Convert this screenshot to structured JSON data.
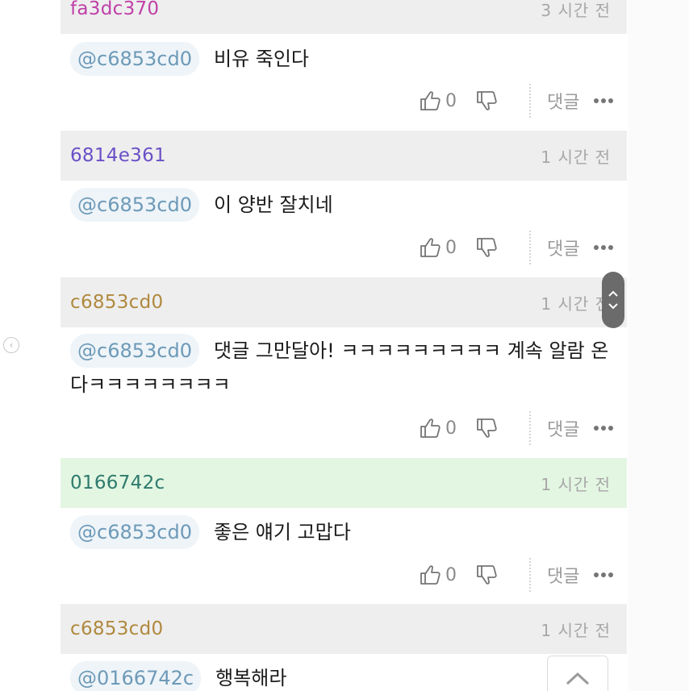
{
  "comments": [
    {
      "author": "fa3dc370",
      "author_color": "#c040a8",
      "time": "3 시간 전",
      "highlighted": false,
      "mention": "@c6853cd0",
      "text": "비유 죽인다",
      "likes": "0",
      "reply_label": "댓글"
    },
    {
      "author": "6814e361",
      "author_color": "#6a4fc7",
      "time": "1 시간 전",
      "highlighted": false,
      "mention": "@c6853cd0",
      "text": "이 양반 잘치네",
      "likes": "0",
      "reply_label": "댓글"
    },
    {
      "author": "c6853cd0",
      "author_color": "#b0893e",
      "time": "1 시간 전",
      "highlighted": false,
      "mention": "@c6853cd0",
      "text": "댓글 그만달아! ㅋㅋㅋㅋㅋㅋㅋㅋㅋ 계속 알람 온다ㅋㅋㅋㅋㅋㅋㅋㅋ",
      "likes": "0",
      "reply_label": "댓글"
    },
    {
      "author": "0166742c",
      "author_color": "#2e7a6c",
      "time": "1 시간 전",
      "highlighted": true,
      "mention": "@c6853cd0",
      "text": "좋은 얘기 고맙다",
      "likes": "0",
      "reply_label": "댓글"
    },
    {
      "author": "c6853cd0",
      "author_color": "#b0893e",
      "time": "1 시간 전",
      "highlighted": false,
      "mention": "@0166742c",
      "text": "행복해라",
      "likes": null,
      "reply_label": null
    }
  ],
  "icons": {
    "thumb_up": "thumbs-up-icon",
    "thumb_down": "thumbs-down-icon",
    "more": "more-dots-icon",
    "scroll_up": "chevron-up-icon",
    "scroll_down": "chevron-down-icon",
    "back_to_top": "chevron-up-icon"
  }
}
